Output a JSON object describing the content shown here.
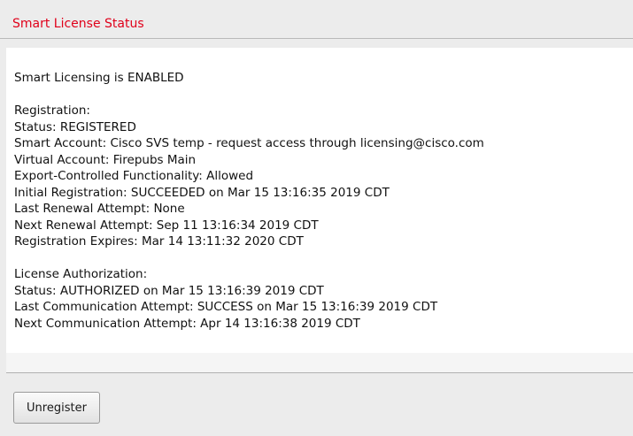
{
  "header": {
    "title": "Smart License Status"
  },
  "status": {
    "lines": [
      "Smart Licensing is ENABLED",
      "",
      "Registration:",
      "Status: REGISTERED",
      "Smart Account: Cisco SVS temp - request access through licensing@cisco.com",
      "Virtual Account: Firepubs Main",
      "Export-Controlled Functionality: Allowed",
      "Initial Registration: SUCCEEDED on Mar 15 13:16:35 2019 CDT",
      "Last Renewal Attempt: None",
      "Next Renewal Attempt: Sep 11 13:16:34 2019 CDT",
      "Registration Expires: Mar 14 13:11:32 2020 CDT",
      "",
      "License Authorization:",
      "Status: AUTHORIZED on Mar 15 13:16:39 2019 CDT",
      "Last Communication Attempt: SUCCESS on Mar 15 13:16:39 2019 CDT",
      "Next Communication Attempt: Apr 14 13:16:38 2019 CDT"
    ]
  },
  "actions": {
    "unregister_label": "Unregister"
  },
  "colors": {
    "title": "#e0001a",
    "background": "#ececec",
    "content_background": "#ffffff"
  }
}
